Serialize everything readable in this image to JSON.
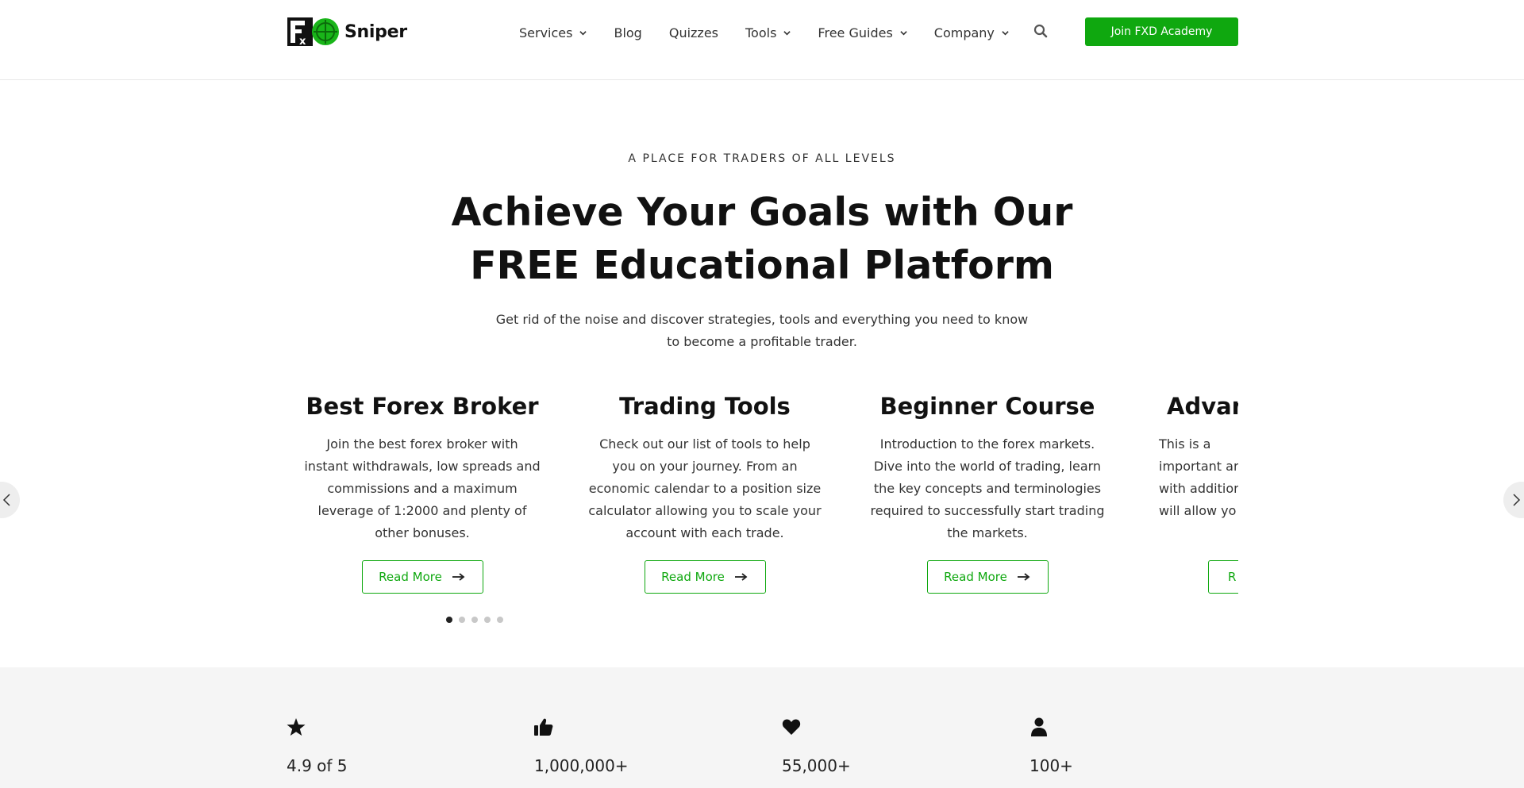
{
  "header": {
    "logo_text": "Sniper",
    "logo_mark_letters": "FXD",
    "nav": [
      {
        "label": "Services",
        "has_dropdown": true
      },
      {
        "label": "Blog",
        "has_dropdown": false
      },
      {
        "label": "Quizzes",
        "has_dropdown": false
      },
      {
        "label": "Tools",
        "has_dropdown": true
      },
      {
        "label": "Free Guides",
        "has_dropdown": true
      },
      {
        "label": "Company",
        "has_dropdown": true
      }
    ],
    "search_icon": "search-icon",
    "cta_label": "Join FXD Academy"
  },
  "hero": {
    "eyebrow": "A PLACE FOR TRADERS OF ALL LEVELS",
    "title": "Achieve Your Goals with Our FREE Educational Platform",
    "subtitle": "Get rid of the noise and discover strategies, tools and everything you need to know to become a profitable trader."
  },
  "carousel": {
    "cards": [
      {
        "title": "Best Forex Broker",
        "text": "Join the best forex broker with instant withdrawals, low spreads and commissions and a maximum leverage of 1:2000 and plenty of other bonuses.",
        "button": "Read More"
      },
      {
        "title": "Trading Tools",
        "text": "Check out our list of tools to help you on your journey. From an economic calendar to a position size calculator allowing you to scale your account with each trade.",
        "button": "Read More"
      },
      {
        "title": "Beginner Course",
        "text": "Introduction to the forex markets. Dive into the world of trading, learn the key concepts and terminologies required to successfully start trading the markets.",
        "button": "Read More"
      },
      {
        "title": "Advan",
        "text": "This is a important art with additior will allow yo",
        "button": "R"
      }
    ],
    "dots_count": 5,
    "active_dot": 0
  },
  "stats": [
    {
      "icon": "star-icon",
      "value": "4.9 of 5"
    },
    {
      "icon": "thumbs-up-icon",
      "value": "1,000,000+"
    },
    {
      "icon": "heart-icon",
      "value": "55,000+"
    },
    {
      "icon": "user-icon",
      "value": "100+"
    }
  ],
  "colors": {
    "accent": "#0fa80f",
    "text": "#111111",
    "stats_bg": "#f5f5f5"
  }
}
